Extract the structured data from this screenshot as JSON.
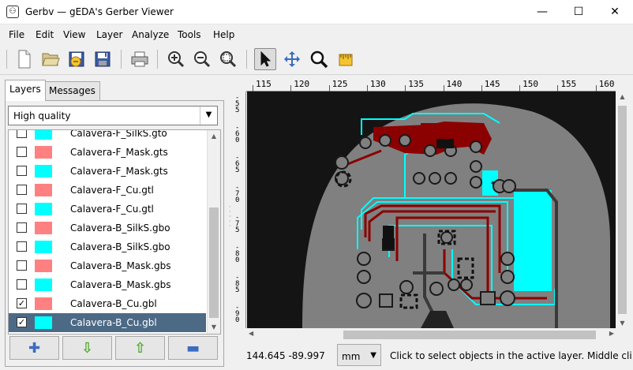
{
  "window": {
    "title": "Gerbv — gEDA's Gerber Viewer",
    "icon": "gerbv-app-icon"
  },
  "window_controls": {
    "minimize": "—",
    "maximize": "☐",
    "close": "✕"
  },
  "menu": [
    "File",
    "Edit",
    "View",
    "Layer",
    "Analyze",
    "Tools",
    "Help"
  ],
  "toolbar": {
    "buttons": [
      "new-icon",
      "open-icon",
      "revert-icon",
      "save-icon",
      "print-icon",
      "zoom-in-icon",
      "zoom-out-icon",
      "zoom-fit-icon",
      "pointer-tool-icon",
      "pan-tool-icon",
      "zoom-tool-icon",
      "measure-tool-icon"
    ],
    "active_tool": "pointer-tool-icon"
  },
  "tabs": [
    "Layers",
    "Messages"
  ],
  "active_tab": "Layers",
  "render_quality": "High quality",
  "layers": [
    {
      "name": "Calavera-F_SilkS.gto",
      "checked": false,
      "color": "#00ffff"
    },
    {
      "name": "Calavera-F_Mask.gts",
      "checked": false,
      "color": "#ff8080"
    },
    {
      "name": "Calavera-F_Mask.gts",
      "checked": false,
      "color": "#00ffff"
    },
    {
      "name": "Calavera-F_Cu.gtl",
      "checked": false,
      "color": "#ff8080"
    },
    {
      "name": "Calavera-F_Cu.gtl",
      "checked": false,
      "color": "#00ffff"
    },
    {
      "name": "Calavera-B_SilkS.gbo",
      "checked": false,
      "color": "#ff8080"
    },
    {
      "name": "Calavera-B_SilkS.gbo",
      "checked": false,
      "color": "#00ffff"
    },
    {
      "name": "Calavera-B_Mask.gbs",
      "checked": false,
      "color": "#ff8080"
    },
    {
      "name": "Calavera-B_Mask.gbs",
      "checked": false,
      "color": "#00ffff"
    },
    {
      "name": "Calavera-B_Cu.gbl",
      "checked": true,
      "color": "#ff8080"
    },
    {
      "name": "Calavera-B_Cu.gbl",
      "checked": true,
      "color": "#00ffff",
      "selected": true
    }
  ],
  "layer_buttons": [
    "add-layer-icon",
    "move-down-icon",
    "move-up-icon",
    "remove-layer-icon"
  ],
  "layer_button_glyphs": [
    "✚",
    "⇩",
    "⇧",
    "▬"
  ],
  "ruler": {
    "top_labels": [
      "115",
      "120",
      "125",
      "130",
      "135",
      "140",
      "145",
      "150",
      "155",
      "160"
    ],
    "left_labels": [
      "-55",
      "-60",
      "-65",
      "-70",
      "-75",
      "-80",
      "-85",
      "-90"
    ]
  },
  "status": {
    "coords": "144.645  -89.997",
    "units": "mm",
    "message": "Click to select objects in the active layer. Middle cli"
  },
  "colors": {
    "selection": "#4c6a86",
    "board": "#808080",
    "copper_red": "#8b0000",
    "copper_cyan": "#00ffff",
    "canvas_bg": "#141414"
  }
}
